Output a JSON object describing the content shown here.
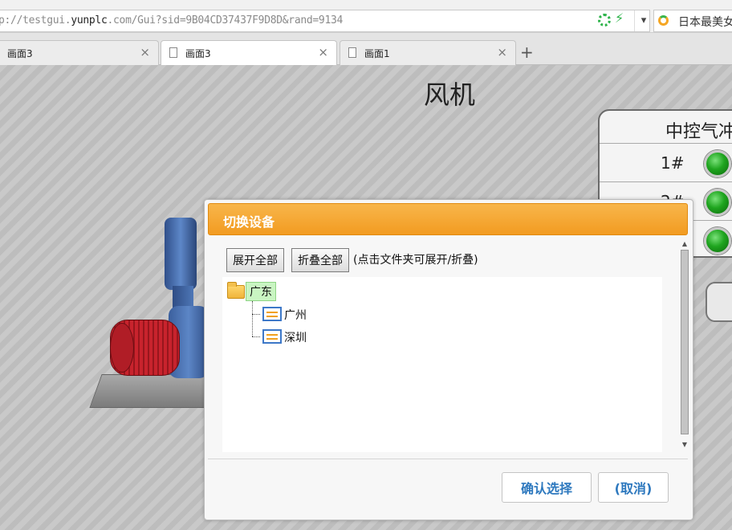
{
  "browser": {
    "url_prefix": "p://testgui.",
    "url_host": "yunplc",
    "url_rest": ".com/Gui?sid=9B04CD37437F9D8D&rand=9134",
    "search_text": "日本最美女",
    "tabs": [
      {
        "label": "画面3",
        "active": false
      },
      {
        "label": "画面3",
        "active": true
      },
      {
        "label": "画面1",
        "active": false
      }
    ],
    "new_tab_label": "+"
  },
  "page": {
    "title": "风机",
    "panel": {
      "title": "中控气冲",
      "rows": [
        {
          "label": "1#"
        },
        {
          "label": "2#"
        },
        {
          "label": ""
        }
      ],
      "led_color": "#1fa51f"
    }
  },
  "dialog": {
    "title": "切换设备",
    "expand_all": "展开全部",
    "collapse_all": "折叠全部",
    "hint": "(点击文件夹可展开/折叠)",
    "tree": {
      "root": "广东",
      "children": [
        "广州",
        "深圳"
      ]
    },
    "confirm": "确认选择",
    "cancel": "(取消)",
    "header_color": "#f29b21",
    "button_text_color": "#2d78be"
  }
}
